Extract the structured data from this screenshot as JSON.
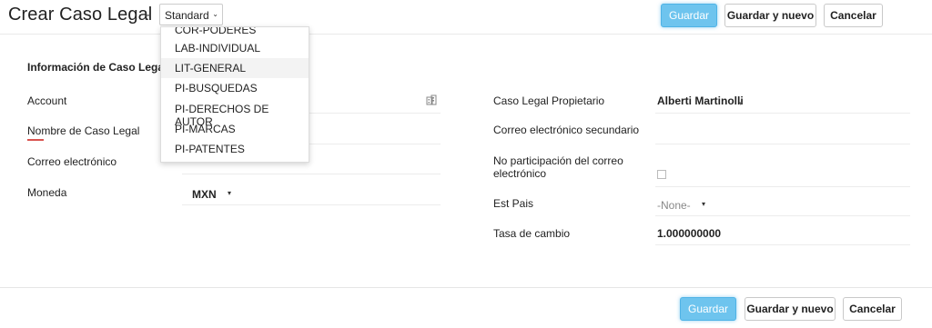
{
  "header": {
    "title": "Crear Caso Legal",
    "title_separator": "-",
    "layout_select": {
      "value": "Standard",
      "caret": "⌄"
    },
    "buttons": {
      "save": "Guardar",
      "save_new": "Guardar y nuevo",
      "cancel": "Cancelar"
    }
  },
  "layout_dropdown": {
    "items": [
      {
        "label": "COR-PODERES",
        "highlighted": false
      },
      {
        "label": "LAB-INDIVIDUAL",
        "highlighted": false
      },
      {
        "label": "LIT-GENERAL",
        "highlighted": true
      },
      {
        "label": "PI-BUSQUEDAS",
        "highlighted": false
      },
      {
        "label": "PI-DERECHOS DE AUTOR",
        "highlighted": false
      },
      {
        "label": "PI-MARCAS",
        "highlighted": false
      },
      {
        "label": "PI-PATENTES",
        "highlighted": false
      }
    ]
  },
  "section": {
    "title": "Información de Caso Legal"
  },
  "left_fields": [
    {
      "label": "Account",
      "value": "",
      "icon": "lookup-icon"
    },
    {
      "label": "Nombre de Caso Legal",
      "value": "",
      "required": true
    },
    {
      "label": "Correo electrónico",
      "value": ""
    },
    {
      "label": "Moneda",
      "value": "MXN",
      "caret": "▾"
    }
  ],
  "right_fields": [
    {
      "label": "Caso Legal Propietario",
      "value": "Alberti Martinolli",
      "caret": "▾"
    },
    {
      "label": "Correo electrónico secundario",
      "value": ""
    },
    {
      "label": "No participación del correo electrónico",
      "value": "",
      "type": "checkbox",
      "checked": false
    },
    {
      "label": "Est Pais",
      "value": "-None-",
      "caret": "▾"
    },
    {
      "label": "Tasa de cambio",
      "value": "1.000000000"
    }
  ],
  "footer": {
    "buttons": {
      "save": "Guardar",
      "save_new": "Guardar y nuevo",
      "cancel": "Cancelar"
    }
  },
  "colors": {
    "primary_button": "#6ec4ee",
    "required_marker": "#d9534f"
  }
}
